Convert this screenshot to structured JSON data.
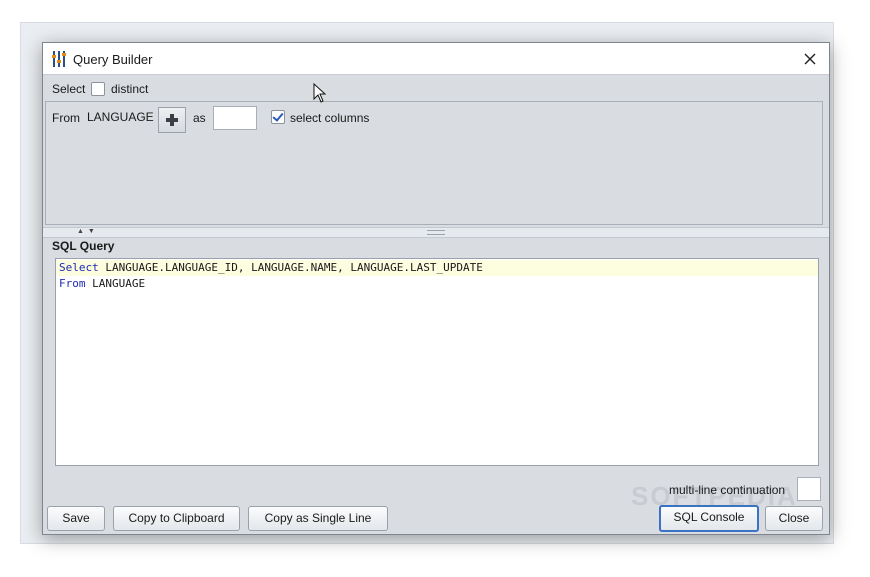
{
  "dialog": {
    "title": "Query Builder"
  },
  "select_row": {
    "select_label": "Select",
    "distinct_label": "distinct",
    "distinct_checked": false
  },
  "from_row": {
    "from_label": "From",
    "table_name": "LANGUAGE",
    "as_label": "as",
    "alias_value": "",
    "select_columns_label": "select columns",
    "select_columns_checked": true
  },
  "sql": {
    "label": "SQL Query",
    "lines": [
      {
        "keyword": "Select",
        "rest": " LANGUAGE.LANGUAGE_ID, LANGUAGE.NAME, LANGUAGE.LAST_UPDATE"
      },
      {
        "keyword": "From",
        "rest": " LANGUAGE"
      }
    ]
  },
  "options": {
    "multiline_label": "multi-line continuation",
    "multiline_value": ""
  },
  "buttons": {
    "save": "Save",
    "copy_clipboard": "Copy to Clipboard",
    "copy_single_line": "Copy as Single Line",
    "sql_console": "SQL Console",
    "close": "Close"
  },
  "watermark": "SOFTPEDIA",
  "colors": {
    "keyword": "#1d2bb3",
    "dialog_bg": "#d9dce1",
    "default_button_border": "#3a72c4",
    "highlight_line": "#fdfde0"
  }
}
